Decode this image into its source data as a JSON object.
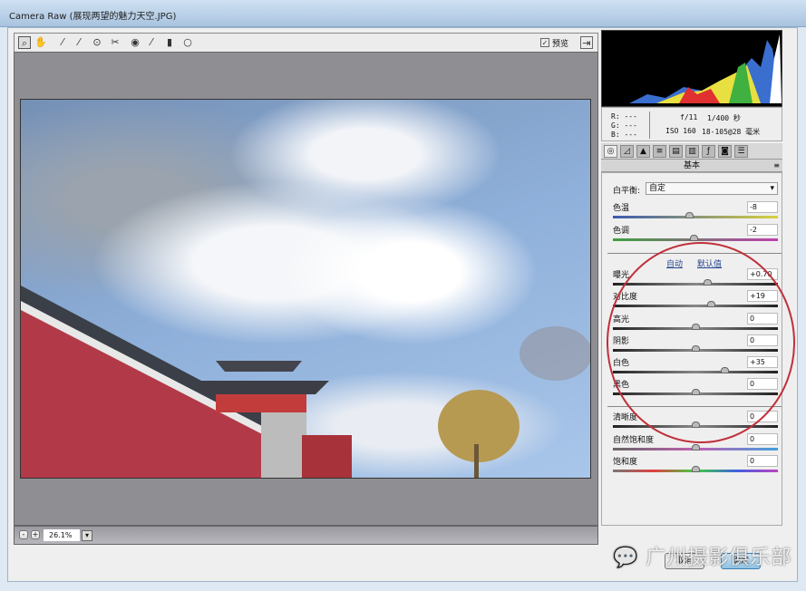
{
  "window": {
    "title": "Camera Raw (展现两望的魅力天空.JPG)"
  },
  "toolbar": {
    "tools": [
      "zoom-tool",
      "hand-tool",
      "white-balance-tool",
      "color-sampler-tool",
      "target-adjust-tool",
      "crop-tool",
      "straighten-tool",
      "spot-removal-tool",
      "red-eye-tool",
      "adjustment-brush-tool",
      "graduated-filter-tool"
    ],
    "preview_label": "预览",
    "preview_checked": true
  },
  "info": {
    "r": "R:  ---",
    "g": "G:  ---",
    "b": "B:  ---",
    "aperture": "f/11",
    "shutter": "1/400 秒",
    "iso": "ISO 160",
    "lens": "18-105@28 毫米"
  },
  "panel": {
    "title": "基本",
    "white_balance_label": "白平衡:",
    "white_balance_value": "自定",
    "auto_label": "自动",
    "default_label": "默认值",
    "sliders": [
      {
        "label": "色温",
        "value": "-8",
        "num": -8,
        "min": -100,
        "max": 100
      },
      {
        "label": "色调",
        "value": "-2",
        "num": -2,
        "min": -100,
        "max": 100
      },
      {
        "label": "曝光",
        "value": "+0.70",
        "num": 0.7,
        "min": -5,
        "max": 5
      },
      {
        "label": "对比度",
        "value": "+19",
        "num": 19,
        "min": -100,
        "max": 100
      },
      {
        "label": "高光",
        "value": "0",
        "num": 0,
        "min": -100,
        "max": 100
      },
      {
        "label": "阴影",
        "value": "0",
        "num": 0,
        "min": -100,
        "max": 100
      },
      {
        "label": "白色",
        "value": "+35",
        "num": 35,
        "min": -100,
        "max": 100
      },
      {
        "label": "黑色",
        "value": "0",
        "num": 0,
        "min": -100,
        "max": 100
      },
      {
        "label": "清晰度",
        "value": "0",
        "num": 0,
        "min": -100,
        "max": 100
      },
      {
        "label": "自然饱和度",
        "value": "0",
        "num": 0,
        "min": -100,
        "max": 100
      },
      {
        "label": "饱和度",
        "value": "0",
        "num": 0,
        "min": -100,
        "max": 100
      }
    ]
  },
  "zoom": {
    "value": "26.1%",
    "minus": "-",
    "plus": "+"
  },
  "buttons": {
    "cancel": "取消",
    "ok": "确定"
  },
  "watermark": "广州摄影俱乐部",
  "colors": {
    "annotation": "#c0303a",
    "wall": "#b23a48"
  }
}
